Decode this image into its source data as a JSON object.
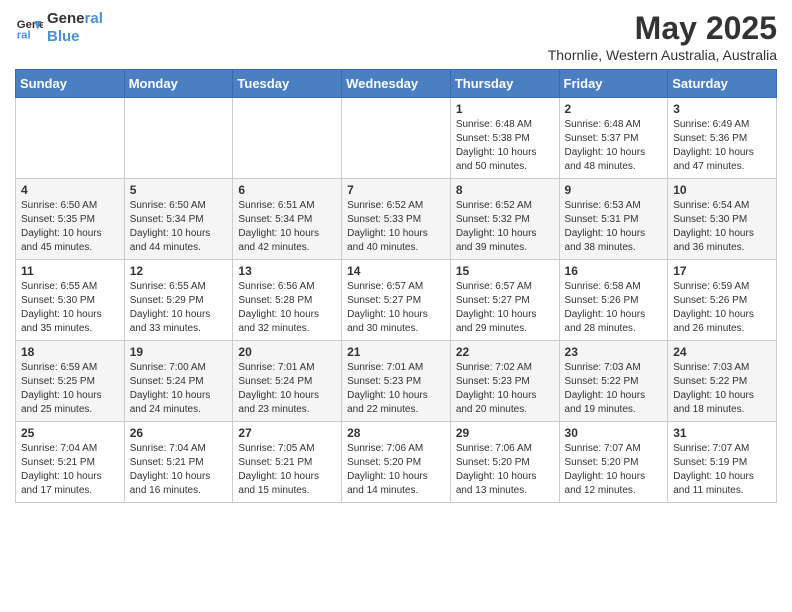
{
  "header": {
    "logo_line1": "General",
    "logo_line2": "Blue",
    "title": "May 2025",
    "subtitle": "Thornlie, Western Australia, Australia"
  },
  "calendar": {
    "days_of_week": [
      "Sunday",
      "Monday",
      "Tuesday",
      "Wednesday",
      "Thursday",
      "Friday",
      "Saturday"
    ],
    "weeks": [
      [
        {
          "day": "",
          "info": ""
        },
        {
          "day": "",
          "info": ""
        },
        {
          "day": "",
          "info": ""
        },
        {
          "day": "",
          "info": ""
        },
        {
          "day": "1",
          "info": "Sunrise: 6:48 AM\nSunset: 5:38 PM\nDaylight: 10 hours\nand 50 minutes."
        },
        {
          "day": "2",
          "info": "Sunrise: 6:48 AM\nSunset: 5:37 PM\nDaylight: 10 hours\nand 48 minutes."
        },
        {
          "day": "3",
          "info": "Sunrise: 6:49 AM\nSunset: 5:36 PM\nDaylight: 10 hours\nand 47 minutes."
        }
      ],
      [
        {
          "day": "4",
          "info": "Sunrise: 6:50 AM\nSunset: 5:35 PM\nDaylight: 10 hours\nand 45 minutes."
        },
        {
          "day": "5",
          "info": "Sunrise: 6:50 AM\nSunset: 5:34 PM\nDaylight: 10 hours\nand 44 minutes."
        },
        {
          "day": "6",
          "info": "Sunrise: 6:51 AM\nSunset: 5:34 PM\nDaylight: 10 hours\nand 42 minutes."
        },
        {
          "day": "7",
          "info": "Sunrise: 6:52 AM\nSunset: 5:33 PM\nDaylight: 10 hours\nand 40 minutes."
        },
        {
          "day": "8",
          "info": "Sunrise: 6:52 AM\nSunset: 5:32 PM\nDaylight: 10 hours\nand 39 minutes."
        },
        {
          "day": "9",
          "info": "Sunrise: 6:53 AM\nSunset: 5:31 PM\nDaylight: 10 hours\nand 38 minutes."
        },
        {
          "day": "10",
          "info": "Sunrise: 6:54 AM\nSunset: 5:30 PM\nDaylight: 10 hours\nand 36 minutes."
        }
      ],
      [
        {
          "day": "11",
          "info": "Sunrise: 6:55 AM\nSunset: 5:30 PM\nDaylight: 10 hours\nand 35 minutes."
        },
        {
          "day": "12",
          "info": "Sunrise: 6:55 AM\nSunset: 5:29 PM\nDaylight: 10 hours\nand 33 minutes."
        },
        {
          "day": "13",
          "info": "Sunrise: 6:56 AM\nSunset: 5:28 PM\nDaylight: 10 hours\nand 32 minutes."
        },
        {
          "day": "14",
          "info": "Sunrise: 6:57 AM\nSunset: 5:27 PM\nDaylight: 10 hours\nand 30 minutes."
        },
        {
          "day": "15",
          "info": "Sunrise: 6:57 AM\nSunset: 5:27 PM\nDaylight: 10 hours\nand 29 minutes."
        },
        {
          "day": "16",
          "info": "Sunrise: 6:58 AM\nSunset: 5:26 PM\nDaylight: 10 hours\nand 28 minutes."
        },
        {
          "day": "17",
          "info": "Sunrise: 6:59 AM\nSunset: 5:26 PM\nDaylight: 10 hours\nand 26 minutes."
        }
      ],
      [
        {
          "day": "18",
          "info": "Sunrise: 6:59 AM\nSunset: 5:25 PM\nDaylight: 10 hours\nand 25 minutes."
        },
        {
          "day": "19",
          "info": "Sunrise: 7:00 AM\nSunset: 5:24 PM\nDaylight: 10 hours\nand 24 minutes."
        },
        {
          "day": "20",
          "info": "Sunrise: 7:01 AM\nSunset: 5:24 PM\nDaylight: 10 hours\nand 23 minutes."
        },
        {
          "day": "21",
          "info": "Sunrise: 7:01 AM\nSunset: 5:23 PM\nDaylight: 10 hours\nand 22 minutes."
        },
        {
          "day": "22",
          "info": "Sunrise: 7:02 AM\nSunset: 5:23 PM\nDaylight: 10 hours\nand 20 minutes."
        },
        {
          "day": "23",
          "info": "Sunrise: 7:03 AM\nSunset: 5:22 PM\nDaylight: 10 hours\nand 19 minutes."
        },
        {
          "day": "24",
          "info": "Sunrise: 7:03 AM\nSunset: 5:22 PM\nDaylight: 10 hours\nand 18 minutes."
        }
      ],
      [
        {
          "day": "25",
          "info": "Sunrise: 7:04 AM\nSunset: 5:21 PM\nDaylight: 10 hours\nand 17 minutes."
        },
        {
          "day": "26",
          "info": "Sunrise: 7:04 AM\nSunset: 5:21 PM\nDaylight: 10 hours\nand 16 minutes."
        },
        {
          "day": "27",
          "info": "Sunrise: 7:05 AM\nSunset: 5:21 PM\nDaylight: 10 hours\nand 15 minutes."
        },
        {
          "day": "28",
          "info": "Sunrise: 7:06 AM\nSunset: 5:20 PM\nDaylight: 10 hours\nand 14 minutes."
        },
        {
          "day": "29",
          "info": "Sunrise: 7:06 AM\nSunset: 5:20 PM\nDaylight: 10 hours\nand 13 minutes."
        },
        {
          "day": "30",
          "info": "Sunrise: 7:07 AM\nSunset: 5:20 PM\nDaylight: 10 hours\nand 12 minutes."
        },
        {
          "day": "31",
          "info": "Sunrise: 7:07 AM\nSunset: 5:19 PM\nDaylight: 10 hours\nand 11 minutes."
        }
      ]
    ]
  }
}
